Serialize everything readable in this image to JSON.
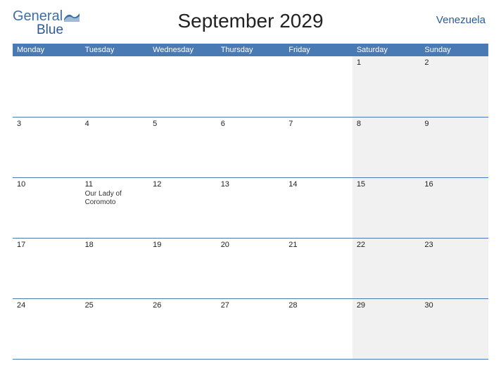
{
  "header": {
    "logo_general": "General",
    "logo_blue": "Blue",
    "title": "September 2029",
    "country": "Venezuela"
  },
  "days": [
    "Monday",
    "Tuesday",
    "Wednesday",
    "Thursday",
    "Friday",
    "Saturday",
    "Sunday"
  ],
  "weeks": [
    [
      {
        "n": ""
      },
      {
        "n": ""
      },
      {
        "n": ""
      },
      {
        "n": ""
      },
      {
        "n": ""
      },
      {
        "n": "1",
        "w": true
      },
      {
        "n": "2",
        "w": true
      }
    ],
    [
      {
        "n": "3"
      },
      {
        "n": "4"
      },
      {
        "n": "5"
      },
      {
        "n": "6"
      },
      {
        "n": "7"
      },
      {
        "n": "8",
        "w": true
      },
      {
        "n": "9",
        "w": true
      }
    ],
    [
      {
        "n": "10"
      },
      {
        "n": "11",
        "e": "Our Lady of Coromoto"
      },
      {
        "n": "12"
      },
      {
        "n": "13"
      },
      {
        "n": "14"
      },
      {
        "n": "15",
        "w": true
      },
      {
        "n": "16",
        "w": true
      }
    ],
    [
      {
        "n": "17"
      },
      {
        "n": "18"
      },
      {
        "n": "19"
      },
      {
        "n": "20"
      },
      {
        "n": "21"
      },
      {
        "n": "22",
        "w": true
      },
      {
        "n": "23",
        "w": true
      }
    ],
    [
      {
        "n": "24"
      },
      {
        "n": "25"
      },
      {
        "n": "26"
      },
      {
        "n": "27"
      },
      {
        "n": "28"
      },
      {
        "n": "29",
        "w": true
      },
      {
        "n": "30",
        "w": true
      }
    ]
  ]
}
